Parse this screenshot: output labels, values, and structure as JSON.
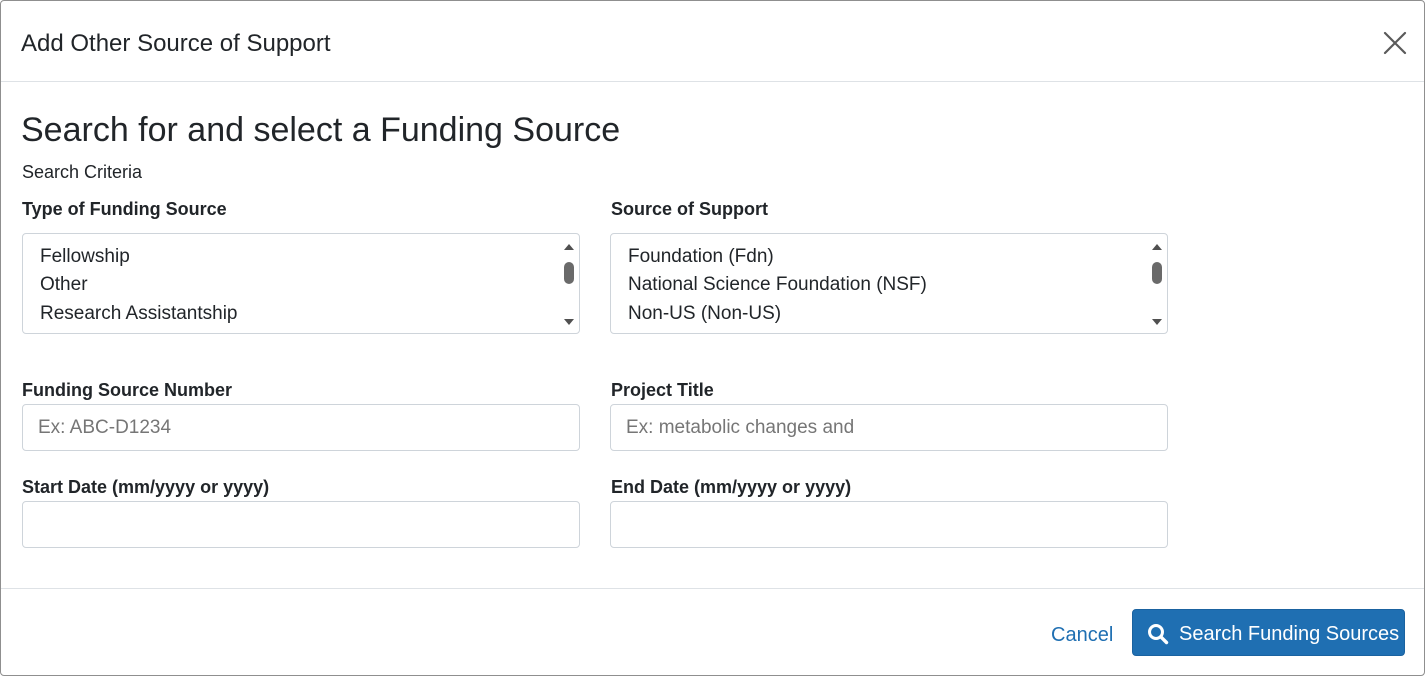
{
  "modal": {
    "title": "Add Other Source of Support",
    "close_icon": "close-icon"
  },
  "form": {
    "heading": "Search for and select a Funding Source",
    "subheading": "Search Criteria",
    "funding_type": {
      "label": "Type of Funding Source",
      "options": [
        "Fellowship",
        "Other",
        "Research Assistantship"
      ]
    },
    "source_of_support": {
      "label": "Source of Support",
      "options": [
        "Foundation (Fdn)",
        "National Science Foundation (NSF)",
        "Non-US (Non-US)"
      ]
    },
    "funding_source_number": {
      "label": "Funding Source Number",
      "value": "",
      "placeholder": "Ex: ABC-D1234"
    },
    "project_title": {
      "label": "Project Title",
      "value": "",
      "placeholder": "Ex: metabolic changes and"
    },
    "start_date": {
      "label": "Start Date (mm/yyyy or yyyy)",
      "value": ""
    },
    "end_date": {
      "label": "End Date (mm/yyyy or yyyy)",
      "value": ""
    }
  },
  "footer": {
    "cancel_label": "Cancel",
    "search_label": "Search Funding Sources",
    "search_icon": "search-icon"
  },
  "colors": {
    "primary": "#1f6fb2",
    "text": "#212529",
    "border": "#ced4da",
    "placeholder": "#767676"
  }
}
